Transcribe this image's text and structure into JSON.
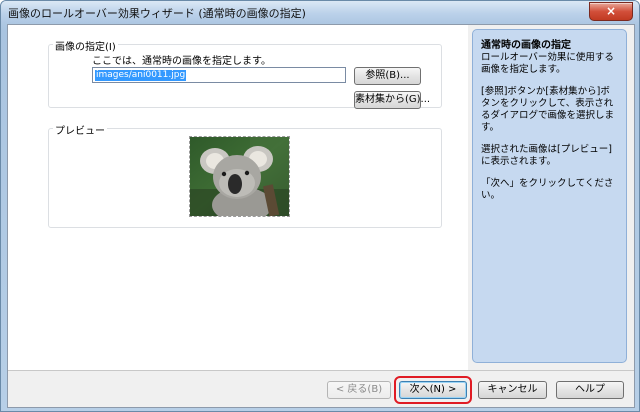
{
  "window": {
    "title": "画像のロールオーバー効果ウィザード (通常時の画像の指定)",
    "close_label": "×"
  },
  "image_group": {
    "label": "画像の指定(I)",
    "description": "ここでは、通常時の画像を指定します。",
    "path_value": "images/ani0011.jpg",
    "browse_label": "参照(B)...",
    "material_label": "素材集から(G)..."
  },
  "preview_group": {
    "label": "プレビュー",
    "image_icon": "koala-photo"
  },
  "side_panel": {
    "title": "通常時の画像の指定",
    "para1": "ロールオーバー効果に使用する画像を指定します。",
    "para2": "[参照]ボタンか[素材集から]ボタンをクリックして、表示されるダイアログで画像を選択します。",
    "para3": "選択された画像は[プレビュー]に表示されます。",
    "para4": "「次へ」をクリックしてください。"
  },
  "footer": {
    "back_label": "< 戻る(B)",
    "next_label": "次へ(N) >",
    "cancel_label": "キャンセル",
    "help_label": "ヘルプ"
  },
  "colors": {
    "side_panel_bg": "#c6d9f0",
    "highlight": "#e01b24",
    "selection": "#3399ff"
  }
}
